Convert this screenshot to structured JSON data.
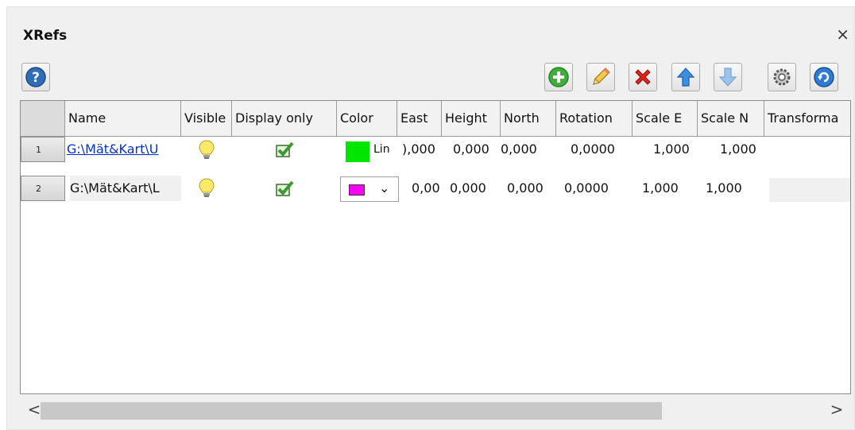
{
  "panel": {
    "title": "XRefs",
    "close_glyph": "×"
  },
  "toolbar": {
    "help_icon": "help-icon",
    "buttons": [
      "add-icon",
      "edit-pencil-icon",
      "delete-icon",
      "move-up-icon",
      "move-down-icon",
      "settings-icon",
      "refresh-icon"
    ]
  },
  "grid": {
    "columns": [
      "Name",
      "Visible",
      "Display only",
      "Color",
      "East",
      "Height",
      "North",
      "Rotation",
      "Scale E",
      "Scale N",
      "Transforma"
    ],
    "rows": [
      {
        "index": "1",
        "name": "G:\\Mät&Kart\\U",
        "color": "#00e600",
        "color_mode": "Lin",
        "east": "),000",
        "height": "0,000",
        "north": "0,000",
        "rotation": "0,0000",
        "scale_e": "1,000",
        "scale_n": "1,000"
      },
      {
        "index": "2",
        "name": "G:\\Mät&Kart\\L",
        "color": "#ff00ff",
        "color_mode": "⌄",
        "east": "0,00",
        "height": "0,000",
        "north": "0,000",
        "rotation": "0,0000",
        "scale_e": "1,000",
        "scale_n": "1,000"
      }
    ]
  },
  "scrollbar": {
    "left_arrow": "<",
    "right_arrow": ">"
  }
}
